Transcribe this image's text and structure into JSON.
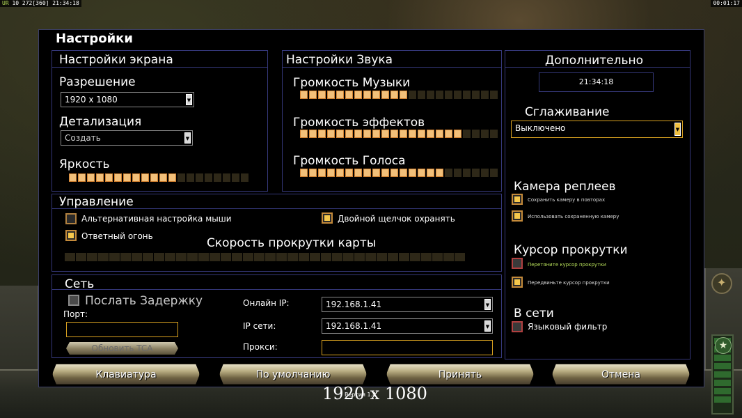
{
  "status_bar": {
    "left_prefix": "UR",
    "left_counts": "10 272[360]",
    "left_time": "21:34:18",
    "right_time": "00:01:17"
  },
  "dialog": {
    "title": "Настройки",
    "display": {
      "title": "Настройки экрана",
      "resolution_label": "Разрешение",
      "resolution_value": "1920 x 1080",
      "detail_label": "Детализация",
      "detail_value": "Создать",
      "brightness_label": "Яркость",
      "brightness_level": 12,
      "brightness_total": 20
    },
    "sound": {
      "title": "Настройки Звука",
      "music_label": "Громкость Музыки",
      "music_level": 12,
      "effects_label": "Громкость эффектов",
      "effects_level": 18,
      "voice_label": "Громкость Голоса",
      "voice_level": 16,
      "slider_total": 22
    },
    "controls": {
      "title": "Управление",
      "alt_mouse_label": "Альтернативная настройка мыши",
      "alt_mouse_checked": false,
      "double_click_label": "Двойной щелчок охранять",
      "double_click_checked": true,
      "return_fire_label": "Ответный огонь",
      "return_fire_checked": true,
      "scroll_speed_label": "Скорость прокрутки карты",
      "scroll_speed_level": 0,
      "scroll_speed_total": 36
    },
    "network": {
      "title": "Сеть",
      "send_delay_label": "Послать Задержку",
      "port_label": "Порт:",
      "port_value": "",
      "update_tca_label": "Обновить TCA",
      "online_ip_label": "Онлайн IP:",
      "online_ip_value": "192.168.1.41",
      "lan_ip_label": "IP сети:",
      "lan_ip_value": "192.168.1.41",
      "proxy_label": "Прокси:",
      "proxy_value": ""
    },
    "extra": {
      "title": "Дополнительно",
      "clock": "21:34:18",
      "antialias_label": "Сглаживание",
      "antialias_value": "Выключено",
      "replay_camera_title": "Камера реплеев",
      "save_camera_label": "Сохранить камеру в повторах",
      "use_saved_camera_label": "Использовать сохраненную камеру",
      "scroll_cursor_title": "Курсор прокрутки",
      "drag_cursor_label": "Перетяните курсор прокрутки",
      "move_cursor_label": "Передвиньте курсор прокрутки",
      "online_title": "В сети",
      "language_filter_label": "Языковый фильтр"
    },
    "buttons": {
      "keyboard": "Клавиатура",
      "defaults": "По умолчанию",
      "accept": "Принять",
      "cancel": "Отмена"
    }
  },
  "overlay": {
    "resolution": "1920 x 1080",
    "version": "Версия 1.4"
  },
  "colors": {
    "slider_on": "#f2c07a",
    "slider_off": "#2e2818",
    "panel_border": "#35387a",
    "accent_gold": "#d9a120",
    "drag_cursor_text": "#b8e05a"
  }
}
